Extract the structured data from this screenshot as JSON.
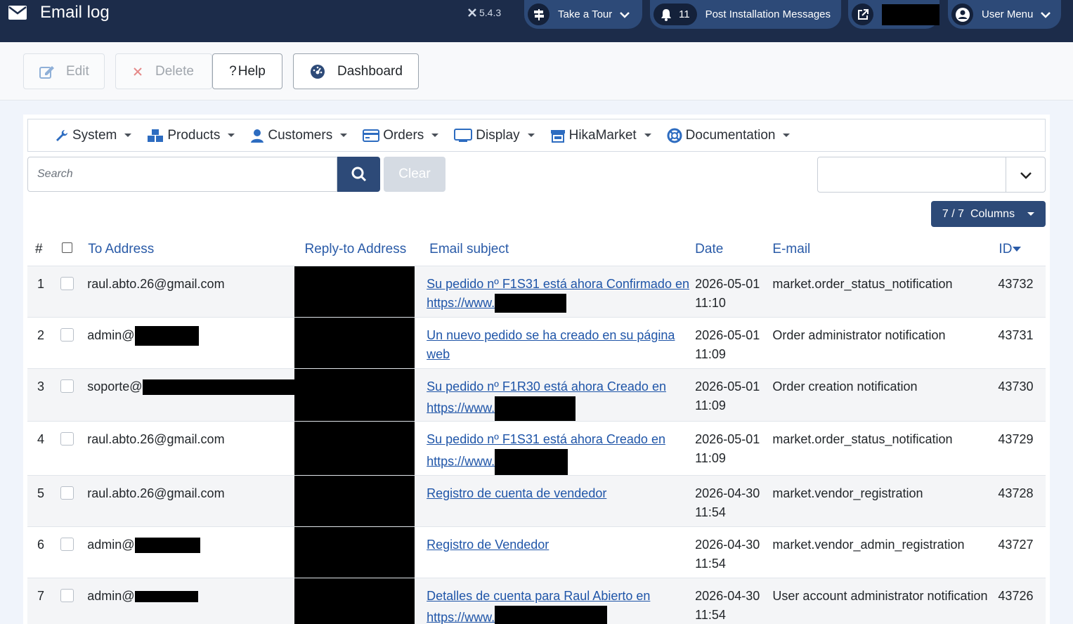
{
  "header": {
    "title": "Email log",
    "version": "5.4.3",
    "tour_label": "Take a Tour",
    "notif_count": "11",
    "notif_label": "Post Installation Messages",
    "user_label": "User Menu"
  },
  "toolbar": {
    "edit_label": "Edit",
    "delete_label": "Delete",
    "help_label": "Help",
    "dashboard_label": "Dashboard"
  },
  "menu": {
    "items": [
      {
        "label": "System",
        "icon": "wrench-icon"
      },
      {
        "label": "Products",
        "icon": "cubes-icon"
      },
      {
        "label": "Customers",
        "icon": "user-icon"
      },
      {
        "label": "Orders",
        "icon": "credit-card-icon"
      },
      {
        "label": "Display",
        "icon": "monitor-icon"
      },
      {
        "label": "HikaMarket",
        "icon": "store-icon"
      },
      {
        "label": "Documentation",
        "icon": "life-ring-icon"
      }
    ]
  },
  "search": {
    "placeholder": "Search",
    "clear_label": "Clear"
  },
  "columns_button": "7 / 7  Columns",
  "table": {
    "headers": {
      "num": "#",
      "to": "To Address",
      "reply": "Reply-to Address",
      "subject": "Email subject",
      "date": "Date",
      "email": "E-mail",
      "id": "ID"
    },
    "rows": [
      {
        "num": "1",
        "to": "raul.abto.26@gmail.com",
        "subject_a": "Su pedido nº F1S31 está ahora Confirmado en",
        "subject_b": "https://www.",
        "date": "2026-05-01",
        "time": "11:10",
        "email": "market.order_status_notification",
        "id": "43732"
      },
      {
        "num": "2",
        "to": "admin@",
        "subject_a": "Un nuevo pedido se ha creado en su página web",
        "subject_b": "",
        "date": "2026-05-01",
        "time": "11:09",
        "email": "Order administrator notification",
        "id": "43731"
      },
      {
        "num": "3",
        "to": "soporte@",
        "subject_a": "Su pedido nº F1R30 está ahora Creado en",
        "subject_b": "https://www.",
        "date": "2026-05-01",
        "time": "11:09",
        "email": "Order creation notification",
        "id": "43730"
      },
      {
        "num": "4",
        "to": "raul.abto.26@gmail.com",
        "subject_a": "Su pedido nº F1S31 está ahora Creado en",
        "subject_b": "https://www.",
        "date": "2026-05-01",
        "time": "11:09",
        "email": "market.order_status_notification",
        "id": "43729"
      },
      {
        "num": "5",
        "to": "raul.abto.26@gmail.com",
        "subject_a": "Registro de cuenta de vendedor",
        "subject_b": "",
        "date": "2026-04-30",
        "time": "11:54",
        "email": "market.vendor_registration",
        "id": "43728"
      },
      {
        "num": "6",
        "to": "admin@",
        "subject_a": "Registro de Vendedor",
        "subject_b": "",
        "date": "2026-04-30",
        "time": "11:54",
        "email": "market.vendor_admin_registration",
        "id": "43727"
      },
      {
        "num": "7",
        "to": "admin@",
        "subject_a": "Detalles de cuenta para Raul Abierto en",
        "subject_b": "https://www.",
        "date": "2026-04-30",
        "time": "11:54",
        "email": "User account administrator notification",
        "id": "43726"
      }
    ]
  },
  "colors": {
    "header_bg": "#1c2c4a",
    "accent": "#2d4a78",
    "link": "#1f55a8"
  }
}
